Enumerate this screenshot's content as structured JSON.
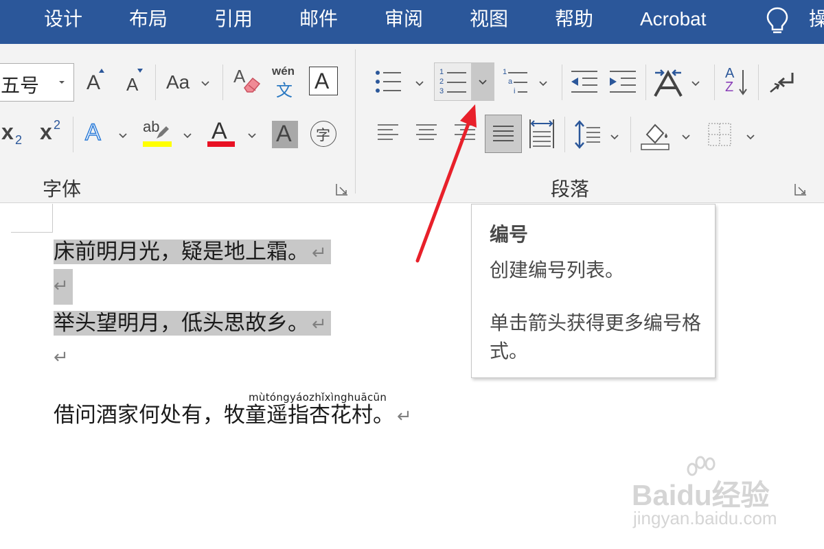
{
  "menu": {
    "tabs": [
      "设计",
      "布局",
      "引用",
      "邮件",
      "审阅",
      "视图",
      "帮助",
      "Acrobat",
      "操"
    ]
  },
  "ribbon": {
    "font_group": {
      "label": "字体",
      "font_size_value": "五号",
      "grow_font_glyph": "A",
      "shrink_font_glyph": "A",
      "change_case_glyph": "Aa",
      "clear_format_glyph": "A",
      "phonetic_top": "wén",
      "phonetic_bottom": "文",
      "char_border_glyph": "A",
      "subscript_glyph": "x",
      "subscript_small": "2",
      "superscript_glyph": "x",
      "superscript_small": "2",
      "text_effect_glyph": "A",
      "highlight_glyph": "ab",
      "font_color_glyph": "A",
      "char_shading_glyph": "A",
      "enclose_char_glyph": "字",
      "highlight_color": "#ffff00",
      "font_color": "#e81123"
    },
    "paragraph_group": {
      "label": "段落",
      "numbering_digits": [
        "1",
        "2",
        "3"
      ],
      "multilevel_marks": [
        "1",
        "a",
        "i"
      ],
      "sort_glyph_top": "A",
      "sort_glyph_bottom": "Z"
    }
  },
  "document": {
    "lines": [
      "床前明月光，疑是地上霜。",
      "举头望明月，低头思故乡。",
      "借问酒家何处有，牧童遥指杏花村。"
    ],
    "paragraph_mark": "↵",
    "pinyin": "mùtóngyáozhǐxìnghuācūn"
  },
  "tooltip": {
    "title": "编号",
    "body": "创建编号列表。",
    "hint": "单击箭头获得更多编号格式。"
  },
  "watermark": {
    "logo": "Baidu经验",
    "url": "jingyan.baidu.com"
  },
  "colors": {
    "tab_bar": "#2b579a",
    "ribbon_bg": "#f3f3f3",
    "selection": "#c8c8c8",
    "annotation_arrow": "#e8202a",
    "icon_blue": "#2b579a"
  }
}
